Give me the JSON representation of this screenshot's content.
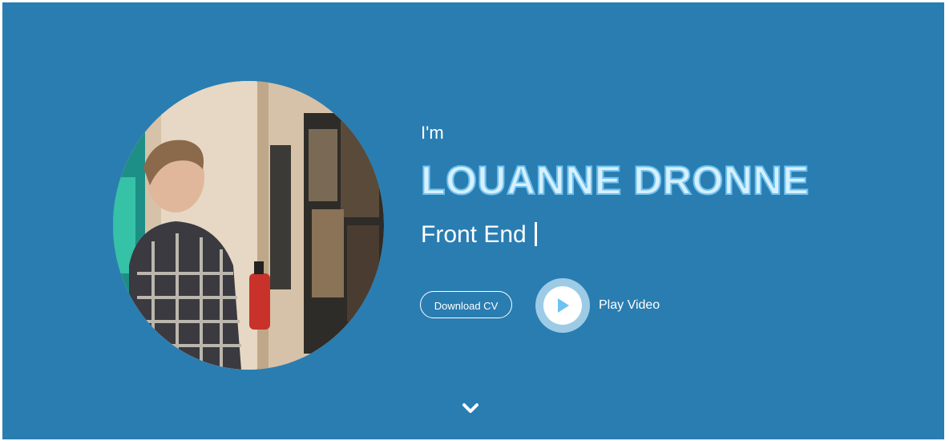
{
  "hero": {
    "intro": "I'm",
    "name": "LOUANNE DRONNE",
    "role": "Front End",
    "download_cv_label": "Download CV",
    "play_video_label": "Play Video"
  },
  "icons": {
    "play": "play-icon",
    "scroll": "chevron-down-icon"
  },
  "colors": {
    "background": "#2a7db1",
    "name_fill": "#d8f0ff",
    "name_outline": "#6ec2f0",
    "play_accent": "#6ec2f0"
  }
}
